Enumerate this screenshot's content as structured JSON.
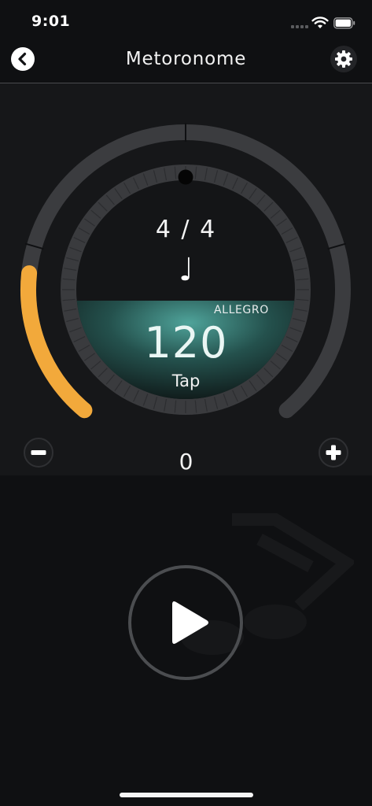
{
  "status_bar": {
    "time": "9:01"
  },
  "nav": {
    "title": "Metoronome",
    "back_icon": "chevron-left-icon",
    "settings_icon": "gear-icon"
  },
  "metronome": {
    "time_signature": "4 / 4",
    "note_value": "♩",
    "tempo_name": "ALLEGRO",
    "bpm": "120",
    "tap_label": "Tap",
    "beat_count": "0",
    "tempo_level": 0.2,
    "colors": {
      "accent": "#f2a93b",
      "track": "#3b3c3f",
      "teal": "#4fa39a"
    }
  },
  "controls": {
    "minus_icon": "minus-icon",
    "plus_icon": "plus-icon",
    "play_icon": "play-icon"
  }
}
